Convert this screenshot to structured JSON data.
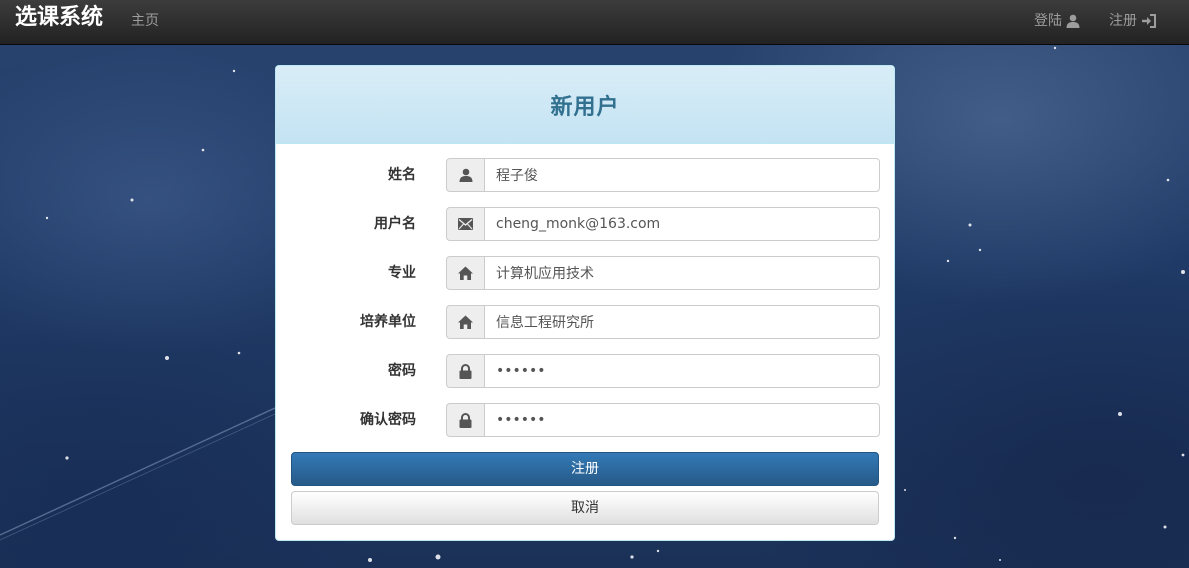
{
  "navbar": {
    "brand": "选课系统",
    "home": "主页",
    "login": "登陆",
    "register": "注册",
    "background_color": "#222222"
  },
  "panel": {
    "title": "新用户",
    "heading_color": "#d9edf7",
    "title_color": "#31708f"
  },
  "form": {
    "fields": [
      {
        "label": "姓名",
        "icon": "user-icon",
        "value": "程子俊",
        "type": "text"
      },
      {
        "label": "用户名",
        "icon": "envelope-icon",
        "value": "cheng_monk@163.com",
        "type": "text"
      },
      {
        "label": "专业",
        "icon": "home-icon",
        "value": "计算机应用技术",
        "type": "text"
      },
      {
        "label": "培养单位",
        "icon": "home-icon",
        "value": "信息工程研究所",
        "type": "text"
      },
      {
        "label": "密码",
        "icon": "lock-icon",
        "value": "••••••",
        "type": "password"
      },
      {
        "label": "确认密码",
        "icon": "lock-icon",
        "value": "••••••",
        "type": "password"
      }
    ],
    "submit_label": "注册",
    "cancel_label": "取消",
    "primary_color": "#337ab7"
  }
}
